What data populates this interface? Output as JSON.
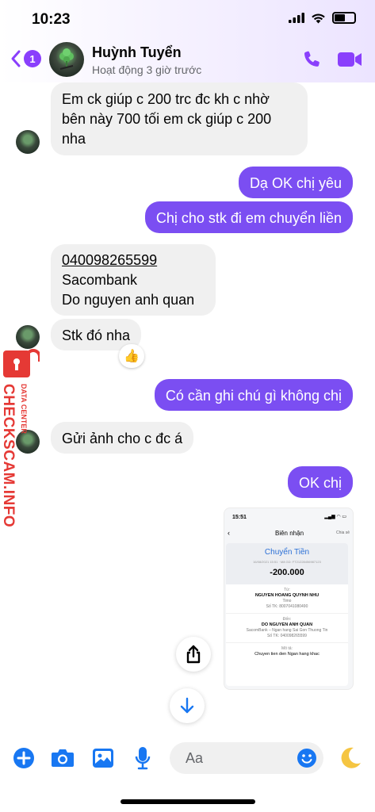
{
  "status_bar": {
    "time": "10:23"
  },
  "header": {
    "back_badge": "1",
    "name": "Huỳnh Tuyển",
    "status": "Hoạt động 3 giờ trước"
  },
  "messages": {
    "m1": {
      "line1": "Em ck giúp c 200 trc đc kh c nhờ",
      "line2": "bên này 700 tối em ck giúp c 200",
      "line3": "nha"
    },
    "m2": "Dạ OK chị yêu",
    "m3": "Chị cho stk đi em chuyển liền",
    "m4": {
      "account": "040098265599",
      "bank": "Sacombank",
      "holder": "Do nguyen anh quan"
    },
    "m5": "Stk đó nha",
    "m5_reaction": "👍",
    "m6": "Có cần ghi chú gì không chị",
    "m7": "Gửi ảnh cho c đc á",
    "m8": "OK chị"
  },
  "receipt": {
    "time": "15:51",
    "title": "Biên nhận",
    "share": "Chia sẻ",
    "heading": "Chuyển Tiền",
    "date_line": "16/08/2021 15:51 · Mã GD: FT21228456987123",
    "amount": "-200.000",
    "from_label": "Từ:",
    "from_name": "NGUYEN HOANG QUYNH NHU",
    "from_bank": "Timo",
    "from_acct": "Số TK: 8007041080490",
    "to_label": "Đến:",
    "to_name": "DO NGUYEN ANH QUAN",
    "to_bank": "SacomBank – Ngan hang Sai Gon Thuong Tin",
    "to_acct": "Số TK: 040098265599",
    "memo_label": "Mô tả:",
    "memo": "Chuyen tien den Ngan hang khac"
  },
  "watermark": {
    "main": "CHECKSCAM.INFO",
    "small": "DATA CENTER"
  },
  "composer": {
    "placeholder": "Aa"
  },
  "colors": {
    "accent": "#7b4ef2",
    "incoming": "#f0f0f0",
    "watermark": "#e53935"
  }
}
